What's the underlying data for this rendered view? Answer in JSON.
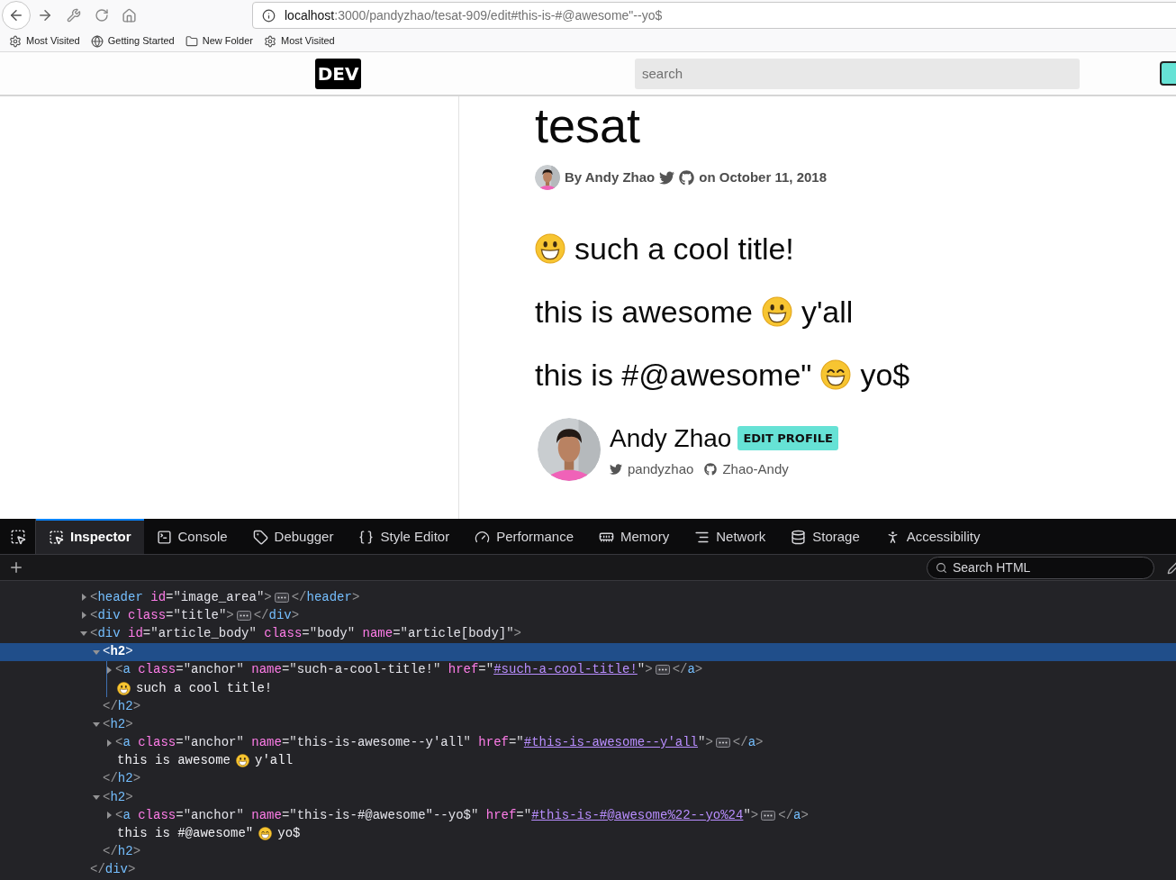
{
  "browser": {
    "url_host": "localhost",
    "url_rest": ":3000/pandyzhao/tesat-909/edit#this-is-#@awesome\"--yo$",
    "bookmarks": [
      {
        "kind": "gear",
        "label": "Most Visited"
      },
      {
        "kind": "globe",
        "label": "Getting Started"
      },
      {
        "kind": "folder",
        "label": "New Folder"
      },
      {
        "kind": "gear",
        "label": "Most Visited"
      }
    ]
  },
  "site": {
    "logo": "DEV",
    "search": {
      "placeholder": "search"
    }
  },
  "article": {
    "title": "tesat",
    "byline": {
      "author": "By Andy Zhao",
      "date": "on October 11, 2018"
    },
    "headings": [
      {
        "kind": "smiley",
        "after": "such a cool title!"
      },
      {
        "before": "this is awesome",
        "kind": "smiley",
        "after": "y'all"
      },
      {
        "before": "this is #@awesome\"",
        "kind": "grin",
        "after": "yo$"
      }
    ],
    "author_card": {
      "name": "Andy Zhao",
      "badge": "EDIT PROFILE",
      "twitter": "pandyzhao",
      "github": "Zhao-Andy"
    }
  },
  "devtools": {
    "tabs": [
      {
        "kind": "inspector",
        "label": "Inspector",
        "selected": true
      },
      {
        "kind": "console",
        "label": "Console",
        "selected": false
      },
      {
        "kind": "debugger",
        "label": "Debugger",
        "selected": false
      },
      {
        "kind": "style-editor",
        "label": "Style Editor",
        "selected": false
      },
      {
        "kind": "performance",
        "label": "Performance",
        "selected": false
      },
      {
        "kind": "memory",
        "label": "Memory",
        "selected": false
      },
      {
        "kind": "network",
        "label": "Network",
        "selected": false
      },
      {
        "kind": "storage",
        "label": "Storage",
        "selected": false
      },
      {
        "kind": "accessibility",
        "label": "Accessibility",
        "selected": false
      }
    ],
    "search": {
      "placeholder": "Search HTML"
    },
    "dom": [
      {
        "kind": "element",
        "expanded": false,
        "selected": false,
        "open": [
          {
            "kind": "punct",
            "text": "<"
          },
          {
            "kind": "tag",
            "text": "header"
          },
          {
            "kind": "attr",
            "text": " id"
          },
          {
            "kind": "quote",
            "text": "=\""
          },
          {
            "kind": "value",
            "text": "image_area"
          },
          {
            "kind": "quote",
            "text": "\""
          },
          {
            "kind": "punct",
            "text": ">"
          }
        ],
        "close": [
          {
            "kind": "punct",
            "text": "</"
          },
          {
            "kind": "tag",
            "text": "header"
          },
          {
            "kind": "punct",
            "text": ">"
          }
        ]
      },
      {
        "kind": "element",
        "expanded": false,
        "selected": false,
        "open": [
          {
            "kind": "punct",
            "text": "<"
          },
          {
            "kind": "tag",
            "text": "div"
          },
          {
            "kind": "attr",
            "text": " class"
          },
          {
            "kind": "quote",
            "text": "=\""
          },
          {
            "kind": "value",
            "text": "title"
          },
          {
            "kind": "quote",
            "text": "\""
          },
          {
            "kind": "punct",
            "text": ">"
          }
        ],
        "close": [
          {
            "kind": "punct",
            "text": "</"
          },
          {
            "kind": "tag",
            "text": "div"
          },
          {
            "kind": "punct",
            "text": ">"
          }
        ]
      },
      {
        "kind": "element",
        "expanded": true,
        "selected": false,
        "open": [
          {
            "kind": "punct",
            "text": "<"
          },
          {
            "kind": "tag",
            "text": "div"
          },
          {
            "kind": "attr",
            "text": " id"
          },
          {
            "kind": "quote",
            "text": "=\""
          },
          {
            "kind": "value",
            "text": "article_body"
          },
          {
            "kind": "quote",
            "text": "\""
          },
          {
            "kind": "attr",
            "text": " class"
          },
          {
            "kind": "quote",
            "text": "=\""
          },
          {
            "kind": "value",
            "text": "body"
          },
          {
            "kind": "quote",
            "text": "\""
          },
          {
            "kind": "attr",
            "text": " name"
          },
          {
            "kind": "quote",
            "text": "=\""
          },
          {
            "kind": "value",
            "text": "article[body]"
          },
          {
            "kind": "quote",
            "text": "\""
          },
          {
            "kind": "punct",
            "text": ">"
          }
        ],
        "close": [
          {
            "kind": "punct",
            "text": "</"
          },
          {
            "kind": "tag",
            "text": "div"
          },
          {
            "kind": "punct",
            "text": ">"
          }
        ],
        "children": [
          {
            "kind": "element",
            "expanded": true,
            "selected": true,
            "open": [
              {
                "kind": "punct",
                "text": "<"
              },
              {
                "kind": "tag",
                "text": "h2"
              },
              {
                "kind": "punct",
                "text": ">"
              }
            ],
            "close": [
              {
                "kind": "punct",
                "text": "</"
              },
              {
                "kind": "tag",
                "text": "h2"
              },
              {
                "kind": "punct",
                "text": ">"
              }
            ],
            "children": [
              {
                "kind": "element",
                "expanded": false,
                "selected": false,
                "open": [
                  {
                    "kind": "punct",
                    "text": "<"
                  },
                  {
                    "kind": "tag",
                    "text": "a"
                  },
                  {
                    "kind": "attr",
                    "text": " class"
                  },
                  {
                    "kind": "quote",
                    "text": "=\""
                  },
                  {
                    "kind": "value",
                    "text": "anchor"
                  },
                  {
                    "kind": "quote",
                    "text": "\""
                  },
                  {
                    "kind": "attr",
                    "text": " name"
                  },
                  {
                    "kind": "quote",
                    "text": "=\""
                  },
                  {
                    "kind": "value",
                    "text": "such-a-cool-title!"
                  },
                  {
                    "kind": "quote",
                    "text": "\""
                  },
                  {
                    "kind": "attr",
                    "text": " href"
                  },
                  {
                    "kind": "quote",
                    "text": "=\""
                  },
                  {
                    "kind": "link",
                    "text": "#such-a-cool-title!"
                  },
                  {
                    "kind": "quote",
                    "text": "\""
                  },
                  {
                    "kind": "punct",
                    "text": ">"
                  }
                ],
                "close": [
                  {
                    "kind": "punct",
                    "text": "</"
                  },
                  {
                    "kind": "tag",
                    "text": "a"
                  },
                  {
                    "kind": "punct",
                    "text": ">"
                  }
                ]
              },
              {
                "kind": "smiley-text",
                "after": "such a cool title!"
              }
            ]
          },
          {
            "kind": "element",
            "expanded": true,
            "selected": false,
            "open": [
              {
                "kind": "punct",
                "text": "<"
              },
              {
                "kind": "tag",
                "text": "h2"
              },
              {
                "kind": "punct",
                "text": ">"
              }
            ],
            "close": [
              {
                "kind": "punct",
                "text": "</"
              },
              {
                "kind": "tag",
                "text": "h2"
              },
              {
                "kind": "punct",
                "text": ">"
              }
            ],
            "children": [
              {
                "kind": "element",
                "expanded": false,
                "selected": false,
                "open": [
                  {
                    "kind": "punct",
                    "text": "<"
                  },
                  {
                    "kind": "tag",
                    "text": "a"
                  },
                  {
                    "kind": "attr",
                    "text": " class"
                  },
                  {
                    "kind": "quote",
                    "text": "=\""
                  },
                  {
                    "kind": "value",
                    "text": "anchor"
                  },
                  {
                    "kind": "quote",
                    "text": "\""
                  },
                  {
                    "kind": "attr",
                    "text": " name"
                  },
                  {
                    "kind": "quote",
                    "text": "=\""
                  },
                  {
                    "kind": "value",
                    "text": "this-is-awesome--y'all"
                  },
                  {
                    "kind": "quote",
                    "text": "\""
                  },
                  {
                    "kind": "attr",
                    "text": " href"
                  },
                  {
                    "kind": "quote",
                    "text": "=\""
                  },
                  {
                    "kind": "link",
                    "text": "#this-is-awesome--y'all"
                  },
                  {
                    "kind": "quote",
                    "text": "\""
                  },
                  {
                    "kind": "punct",
                    "text": ">"
                  }
                ],
                "close": [
                  {
                    "kind": "punct",
                    "text": "</"
                  },
                  {
                    "kind": "tag",
                    "text": "a"
                  },
                  {
                    "kind": "punct",
                    "text": ">"
                  }
                ]
              },
              {
                "kind": "smiley-text",
                "before": "this is awesome",
                "after": "y'all"
              }
            ]
          },
          {
            "kind": "element",
            "expanded": true,
            "selected": false,
            "open": [
              {
                "kind": "punct",
                "text": "<"
              },
              {
                "kind": "tag",
                "text": "h2"
              },
              {
                "kind": "punct",
                "text": ">"
              }
            ],
            "close": [
              {
                "kind": "punct",
                "text": "</"
              },
              {
                "kind": "tag",
                "text": "h2"
              },
              {
                "kind": "punct",
                "text": ">"
              }
            ],
            "children": [
              {
                "kind": "element",
                "expanded": false,
                "selected": false,
                "open": [
                  {
                    "kind": "punct",
                    "text": "<"
                  },
                  {
                    "kind": "tag",
                    "text": "a"
                  },
                  {
                    "kind": "attr",
                    "text": " class"
                  },
                  {
                    "kind": "quote",
                    "text": "=\""
                  },
                  {
                    "kind": "value",
                    "text": "anchor"
                  },
                  {
                    "kind": "quote",
                    "text": "\""
                  },
                  {
                    "kind": "attr",
                    "text": " name"
                  },
                  {
                    "kind": "quote",
                    "text": "=\""
                  },
                  {
                    "kind": "value",
                    "text": "this-is-#@awesome\"--yo$"
                  },
                  {
                    "kind": "quote",
                    "text": "\""
                  },
                  {
                    "kind": "attr",
                    "text": " href"
                  },
                  {
                    "kind": "quote",
                    "text": "=\""
                  },
                  {
                    "kind": "link",
                    "text": "#this-is-#@awesome%22--yo%24"
                  },
                  {
                    "kind": "quote",
                    "text": "\""
                  },
                  {
                    "kind": "punct",
                    "text": ">"
                  }
                ],
                "close": [
                  {
                    "kind": "punct",
                    "text": "</"
                  },
                  {
                    "kind": "tag",
                    "text": "a"
                  },
                  {
                    "kind": "punct",
                    "text": ">"
                  }
                ]
              },
              {
                "kind": "grin-text",
                "before": "this is #@awesome\"",
                "after": "yo$"
              }
            ]
          }
        ]
      }
    ]
  }
}
